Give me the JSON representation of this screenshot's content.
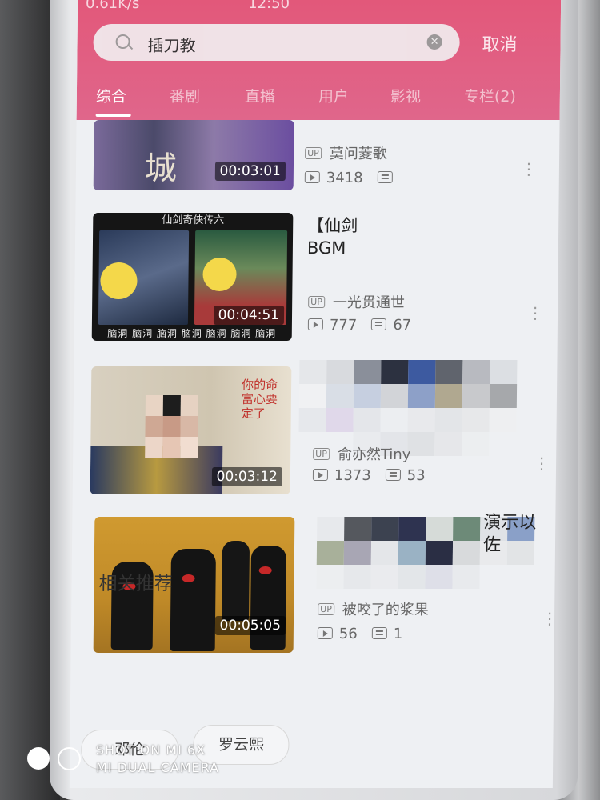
{
  "status_bar": {
    "speed": "0.61K/s",
    "time": "12:50"
  },
  "search": {
    "query": "插刀教",
    "cancel_label": "取消"
  },
  "tabs": [
    {
      "label": "综合",
      "active": true
    },
    {
      "label": "番剧"
    },
    {
      "label": "直播"
    },
    {
      "label": "用户"
    },
    {
      "label": "影视"
    },
    {
      "label": "专栏(2)"
    }
  ],
  "videos": [
    {
      "duration": "00:03:01",
      "uploader": "莫问菱歌",
      "plays": "3418",
      "danmu": "",
      "thumb_text": "城"
    },
    {
      "duration": "00:04:51",
      "title_line1": "【仙剑",
      "title_line2": "BGM",
      "uploader": "一光贯通世",
      "plays": "777",
      "danmu": "67",
      "thumb_caption": "仙剑奇侠传六",
      "thumb_subtitle": "脑洞 脑洞 脑洞 脑洞 脑洞 脑洞 脑洞"
    },
    {
      "duration": "00:03:12",
      "uploader": "俞亦然Tiny",
      "plays": "1373",
      "danmu": "53",
      "thumb_poem": "你的命 富心要定了"
    },
    {
      "duration": "00:05:05",
      "title_fragment_1": "演示以",
      "title_fragment_2": "佐",
      "uploader": "被咬了的浆果",
      "plays": "56",
      "danmu": "1"
    }
  ],
  "related": {
    "heading": "相关推荐",
    "chips": [
      "邓伦",
      "罗云熙"
    ]
  },
  "watermark": {
    "line1": "SHOT ON MI 6X",
    "line2": "MI DUAL CAMERA"
  },
  "colors": {
    "header_pink": "#e2587a",
    "background": "#eef0f3"
  }
}
